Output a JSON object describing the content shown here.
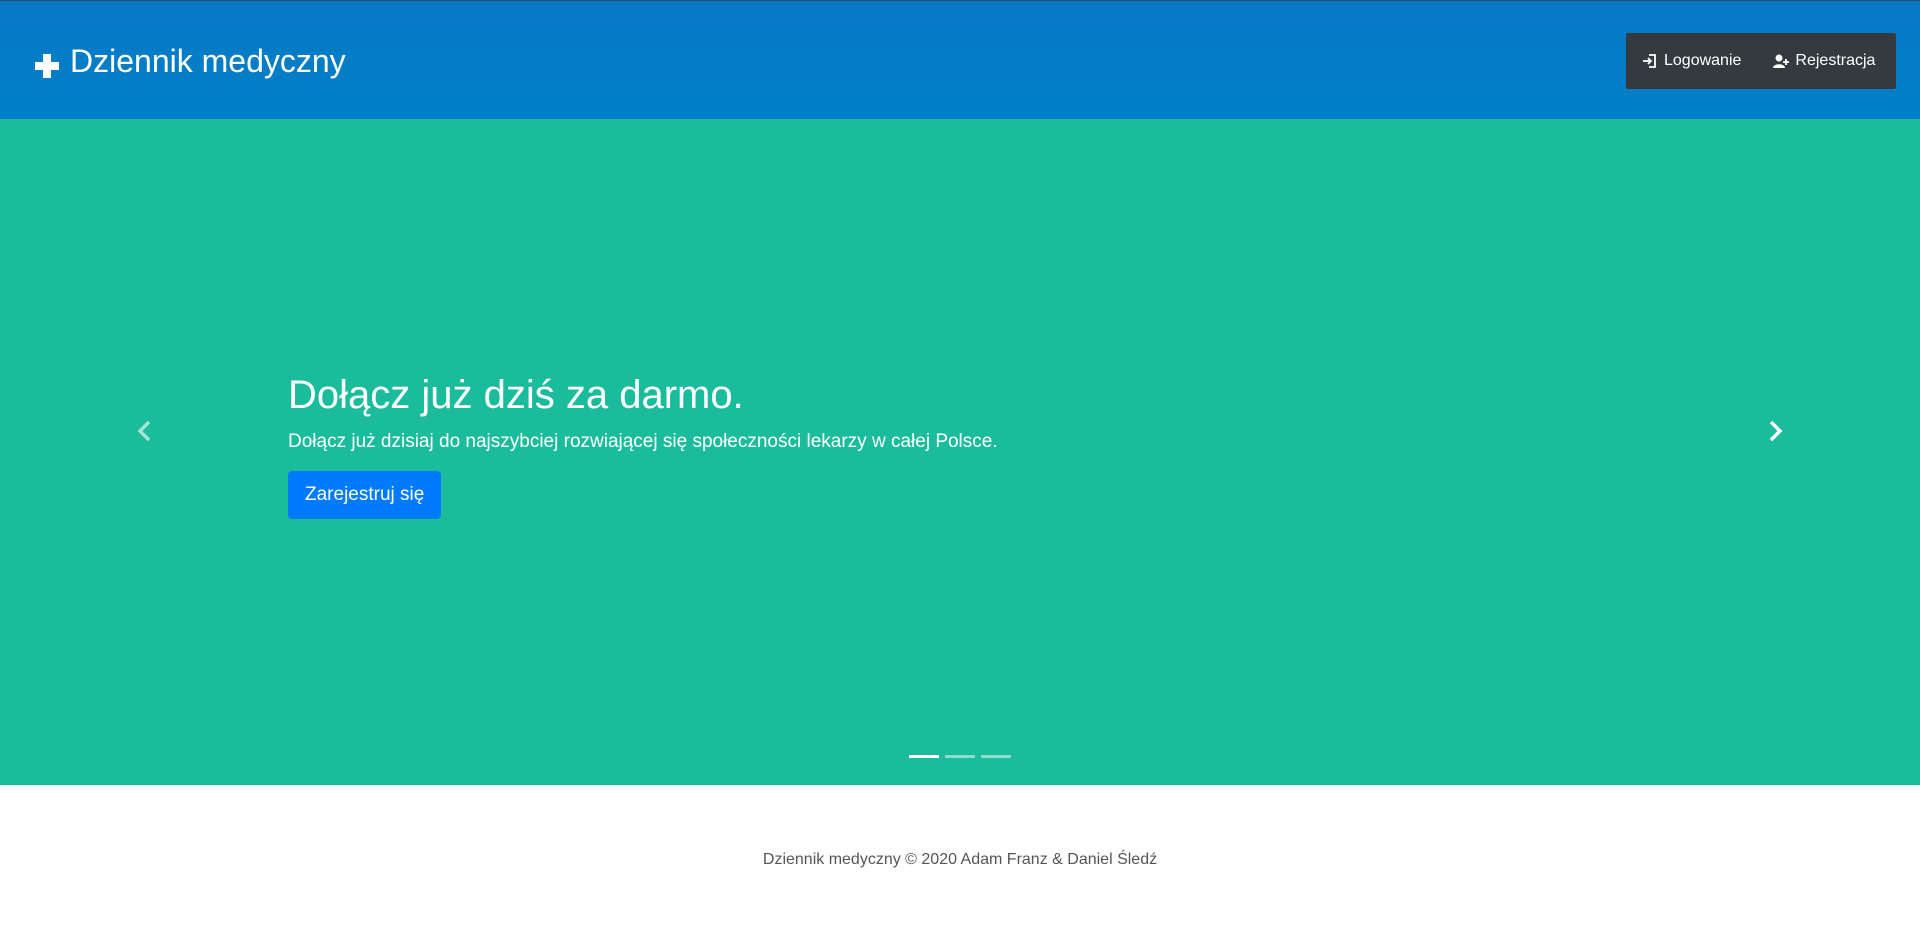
{
  "navbar": {
    "brand": "Dziennik medyczny",
    "brand_icon": "plus-icon",
    "links": [
      {
        "label": "Logowanie",
        "icon": "sign-in-icon"
      },
      {
        "label": "Rejestracja",
        "icon": "user-plus-icon"
      }
    ]
  },
  "carousel": {
    "heading": "Dołącz już dziś za darmo.",
    "text": "Dołącz już dzisiaj do najszybciej rozwiającej się społeczności lekarzy w całej Polsce.",
    "button": "Zarejestruj się",
    "prev_icon": "chevron-left-icon",
    "next_icon": "chevron-right-icon",
    "indicators": 3,
    "active_index": 0
  },
  "footer": {
    "text": "Dziennik medyczny © 2020 Adam Franz & Daniel Śledź"
  },
  "colors": {
    "navbar": "#0080c8",
    "nav_right_bg": "#343a40",
    "carousel_bg": "#1abc9c",
    "button": "#007bff"
  }
}
